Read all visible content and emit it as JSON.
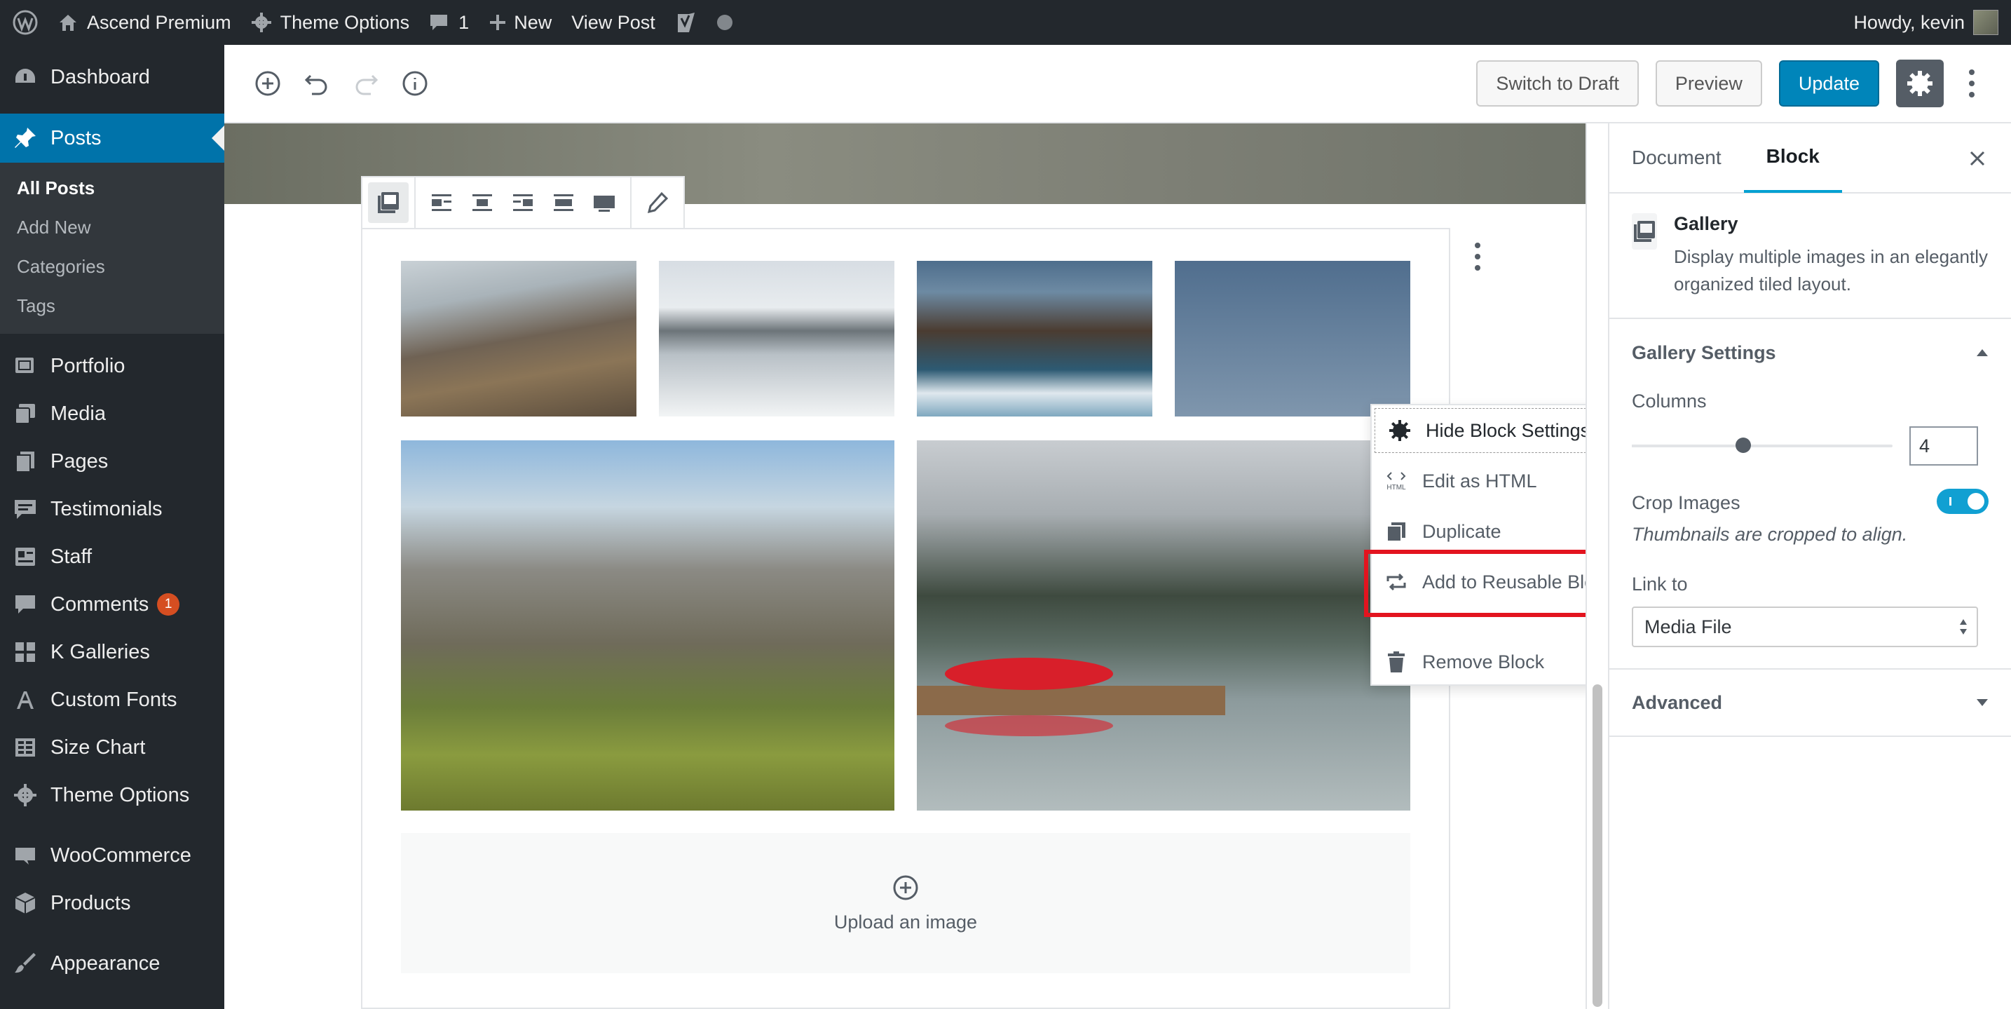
{
  "adminbar": {
    "site_name": "Ascend Premium",
    "theme_options": "Theme Options",
    "comments_count": "1",
    "new_label": "New",
    "view_post": "View Post",
    "greeting": "Howdy, kevin"
  },
  "sidebar": {
    "dashboard": "Dashboard",
    "posts": "Posts",
    "posts_sub": [
      "All Posts",
      "Add New",
      "Categories",
      "Tags"
    ],
    "portfolio": "Portfolio",
    "media": "Media",
    "pages": "Pages",
    "testimonials": "Testimonials",
    "staff": "Staff",
    "comments": "Comments",
    "comments_badge": "1",
    "k_galleries": "K Galleries",
    "custom_fonts": "Custom Fonts",
    "size_chart": "Size Chart",
    "theme_options": "Theme Options",
    "woocommerce": "WooCommerce",
    "products": "Products",
    "appearance": "Appearance"
  },
  "header": {
    "switch_to_draft": "Switch to Draft",
    "preview": "Preview",
    "update": "Update"
  },
  "gallery": {
    "upload_label": "Upload an image"
  },
  "block_menu": {
    "hide_settings": "Hide Block Settings",
    "edit_html": "Edit as HTML",
    "duplicate": "Duplicate",
    "add_reusable": "Add to Reusable Blocks",
    "remove": "Remove Block"
  },
  "inspector": {
    "tab_document": "Document",
    "tab_block": "Block",
    "block_title": "Gallery",
    "block_description": "Display multiple images in an elegantly organized tiled layout.",
    "gallery_settings": "Gallery Settings",
    "columns_label": "Columns",
    "columns_value": "4",
    "columns_min": 1,
    "columns_max": 8,
    "crop_label": "Crop Images",
    "crop_enabled": true,
    "crop_help": "Thumbnails are cropped to align.",
    "link_to_label": "Link to",
    "link_to_value": "Media File",
    "advanced": "Advanced"
  },
  "colors": {
    "accent": "#0073aa",
    "highlight": "#e3141f",
    "admin_dark": "#23282d"
  }
}
